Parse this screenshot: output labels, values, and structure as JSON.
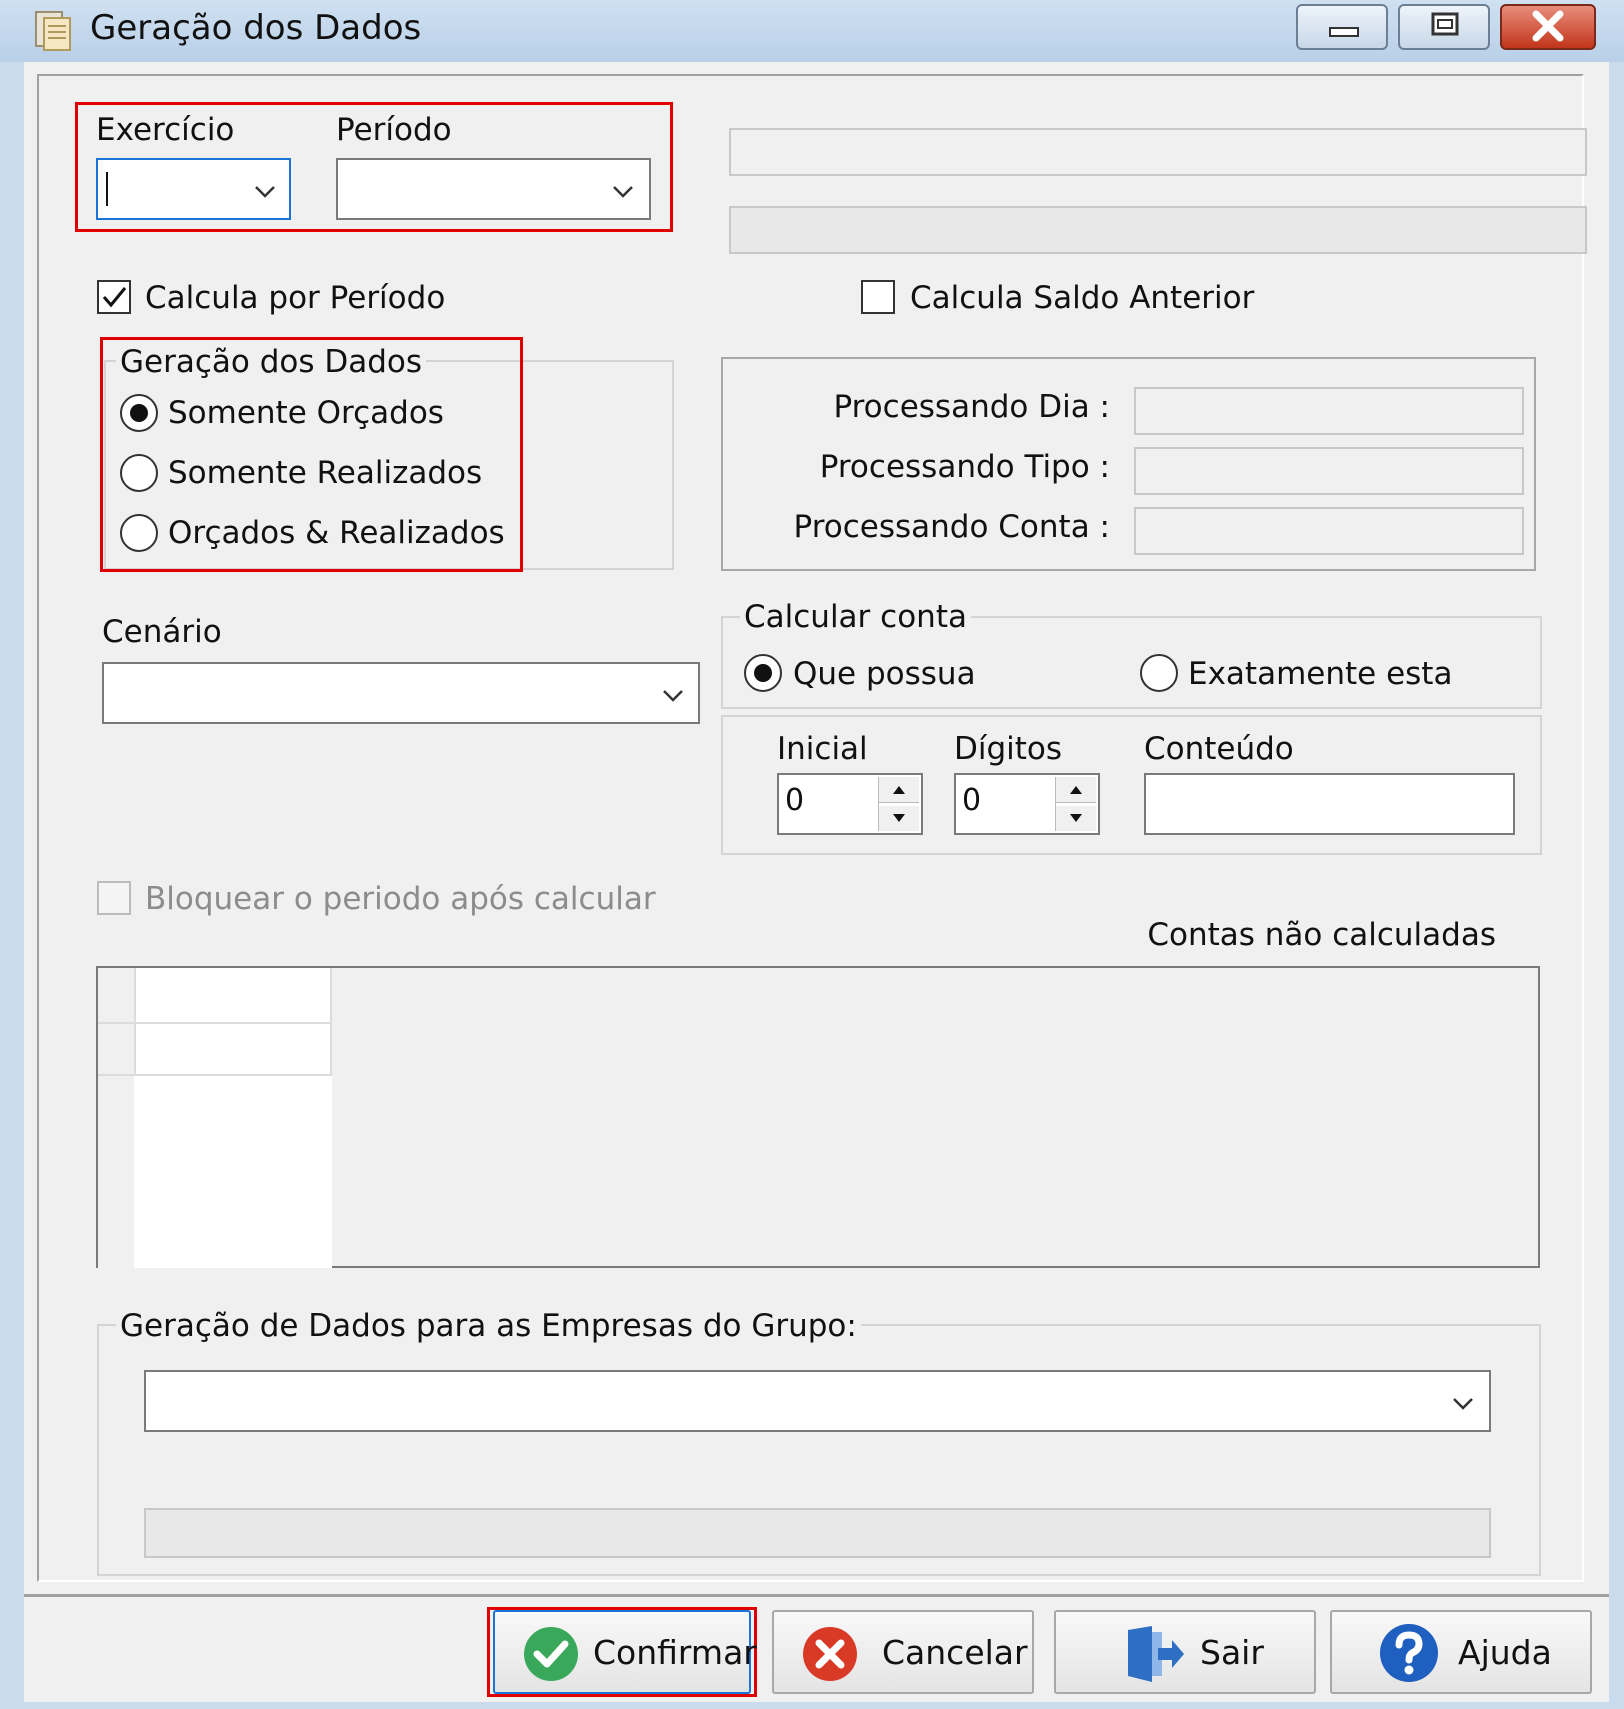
{
  "window": {
    "title": "Geração dos Dados",
    "title_icon": "app-icon",
    "controls": [
      "minimize-icon",
      "maximize-icon",
      "close-icon"
    ]
  },
  "exercicio": {
    "label": "Exercício",
    "value": ""
  },
  "periodo": {
    "label": "Período",
    "value": ""
  },
  "calcula_por_periodo": {
    "label": "Calcula por Período",
    "checked": true
  },
  "calcula_saldo_anterior": {
    "label": "Calcula Saldo Anterior",
    "checked": false
  },
  "geracao_group": {
    "title": "Geração dos Dados",
    "options": [
      {
        "label": "Somente Orçados",
        "selected": true
      },
      {
        "label": "Somente Realizados",
        "selected": false
      },
      {
        "label": "Orçados & Realizados",
        "selected": false
      }
    ]
  },
  "processing": {
    "dia_label": "Processando Dia :",
    "tipo_label": "Processando Tipo :",
    "conta_label": "Processando Conta :"
  },
  "cenario": {
    "label": "Cenário",
    "value": ""
  },
  "calcular_conta": {
    "title": "Calcular conta",
    "options": [
      {
        "label": "Que possua",
        "selected": true
      },
      {
        "label": "Exatamente esta",
        "selected": false
      }
    ]
  },
  "inicial": {
    "label": "Inicial",
    "value": "0"
  },
  "digitos": {
    "label": "Dígitos",
    "value": "0"
  },
  "conteudo": {
    "label": "Conteúdo",
    "value": ""
  },
  "bloquear": {
    "label": "Bloquear o periodo após calcular",
    "checked": false,
    "disabled": true
  },
  "contas_nao_calculadas": {
    "label": "Contas não calculadas"
  },
  "empresas_group": {
    "title": "Geração de Dados para as Empresas do Grupo:",
    "value": ""
  },
  "buttons": {
    "confirmar": {
      "label": "Confirmar",
      "icon": "check-icon",
      "color": "#3aa85a"
    },
    "cancelar": {
      "label": "Cancelar",
      "icon": "x-circle-icon",
      "color": "#d93a26"
    },
    "sair": {
      "label": "Sair",
      "icon": "exit-door-icon",
      "color": "#2e6fc4"
    },
    "ajuda": {
      "label": "Ajuda",
      "icon": "help-icon",
      "color": "#1f5fbf"
    }
  }
}
